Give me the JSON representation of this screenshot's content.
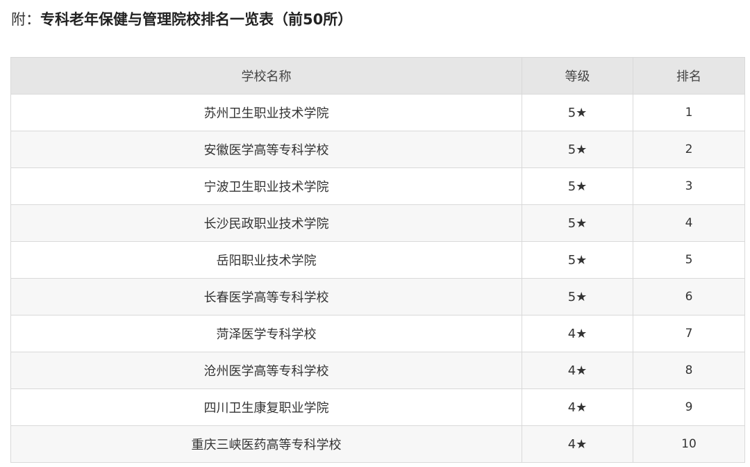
{
  "heading": {
    "prefix": "附：",
    "title": "专科老年保健与管理院校排名一览表（前50所）"
  },
  "table": {
    "columns": [
      "学校名称",
      "等级",
      "排名"
    ],
    "rows": [
      {
        "school": "苏州卫生职业技术学院",
        "grade": "5★",
        "rank": "1"
      },
      {
        "school": "安徽医学高等专科学校",
        "grade": "5★",
        "rank": "2"
      },
      {
        "school": "宁波卫生职业技术学院",
        "grade": "5★",
        "rank": "3"
      },
      {
        "school": "长沙民政职业技术学院",
        "grade": "5★",
        "rank": "4"
      },
      {
        "school": "岳阳职业技术学院",
        "grade": "5★",
        "rank": "5"
      },
      {
        "school": "长春医学高等专科学校",
        "grade": "5★",
        "rank": "6"
      },
      {
        "school": "菏泽医学专科学校",
        "grade": "4★",
        "rank": "7"
      },
      {
        "school": "沧州医学高等专科学校",
        "grade": "4★",
        "rank": "8"
      },
      {
        "school": "四川卫生康复职业学院",
        "grade": "4★",
        "rank": "9"
      },
      {
        "school": "重庆三峡医药高等专科学校",
        "grade": "4★",
        "rank": "10"
      }
    ]
  }
}
